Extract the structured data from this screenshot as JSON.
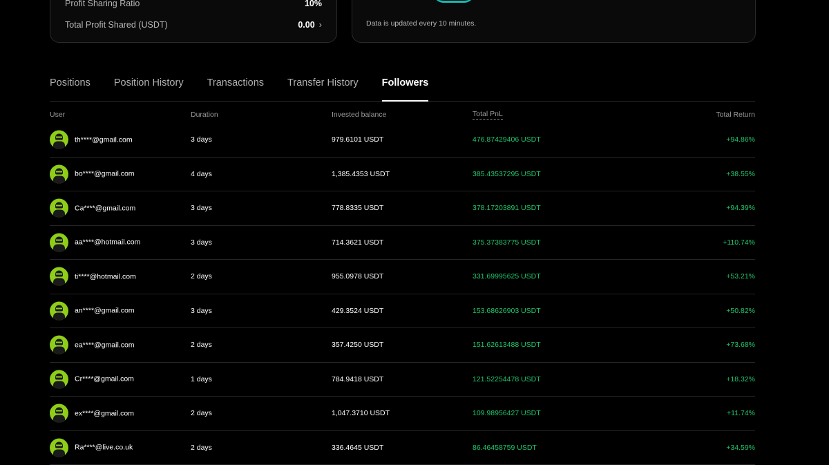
{
  "summary": {
    "profit_sharing_label": "Profit Sharing Ratio",
    "profit_sharing_value": "10%",
    "total_profit_label": "Total Profit Shared (USDT)",
    "total_profit_value": "0.00",
    "update_note": "Data is updated every 10 minutes."
  },
  "tabs": [
    {
      "label": "Positions",
      "active": false
    },
    {
      "label": "Position History",
      "active": false
    },
    {
      "label": "Transactions",
      "active": false
    },
    {
      "label": "Transfer History",
      "active": false
    },
    {
      "label": "Followers",
      "active": true
    }
  ],
  "table": {
    "headers": {
      "user": "User",
      "duration": "Duration",
      "invested": "Invested balance",
      "pnl": "Total PnL",
      "return": "Total Return"
    },
    "rows": [
      {
        "user": "th****@gmail.com",
        "duration": "3 days",
        "invested": "979.6101 USDT",
        "pnl": "476.87429406 USDT",
        "return": "+94.86%"
      },
      {
        "user": "bo****@gmail.com",
        "duration": "4 days",
        "invested": "1,385.4353 USDT",
        "pnl": "385.43537295 USDT",
        "return": "+38.55%"
      },
      {
        "user": "Ca****@gmail.com",
        "duration": "3 days",
        "invested": "778.8335 USDT",
        "pnl": "378.17203891 USDT",
        "return": "+94.39%"
      },
      {
        "user": "aa****@hotmail.com",
        "duration": "3 days",
        "invested": "714.3621 USDT",
        "pnl": "375.37383775 USDT",
        "return": "+110.74%"
      },
      {
        "user": "ti****@hotmail.com",
        "duration": "2 days",
        "invested": "955.0978 USDT",
        "pnl": "331.69995625 USDT",
        "return": "+53.21%"
      },
      {
        "user": "an****@gmail.com",
        "duration": "3 days",
        "invested": "429.3524 USDT",
        "pnl": "153.68626903 USDT",
        "return": "+50.82%"
      },
      {
        "user": "ea****@gmail.com",
        "duration": "2 days",
        "invested": "357.4250 USDT",
        "pnl": "151.62613488 USDT",
        "return": "+73.68%"
      },
      {
        "user": "Cr****@gmail.com",
        "duration": "1 days",
        "invested": "784.9418 USDT",
        "pnl": "121.52254478 USDT",
        "return": "+18.32%"
      },
      {
        "user": "ex****@gmail.com",
        "duration": "2 days",
        "invested": "1,047.3710 USDT",
        "pnl": "109.98956427 USDT",
        "return": "+11.74%"
      },
      {
        "user": "Ra****@live.co.uk",
        "duration": "2 days",
        "invested": "336.4645 USDT",
        "pnl": "86.46458759 USDT",
        "return": "+34.59%"
      }
    ]
  },
  "colors": {
    "background": "#000000",
    "positive": "#20c66a",
    "avatar": "#8fce18",
    "divider": "#262626"
  },
  "icons": {
    "total_profit_chevron": "chevron-right-icon",
    "avatar": "robot-avatar-icon"
  }
}
